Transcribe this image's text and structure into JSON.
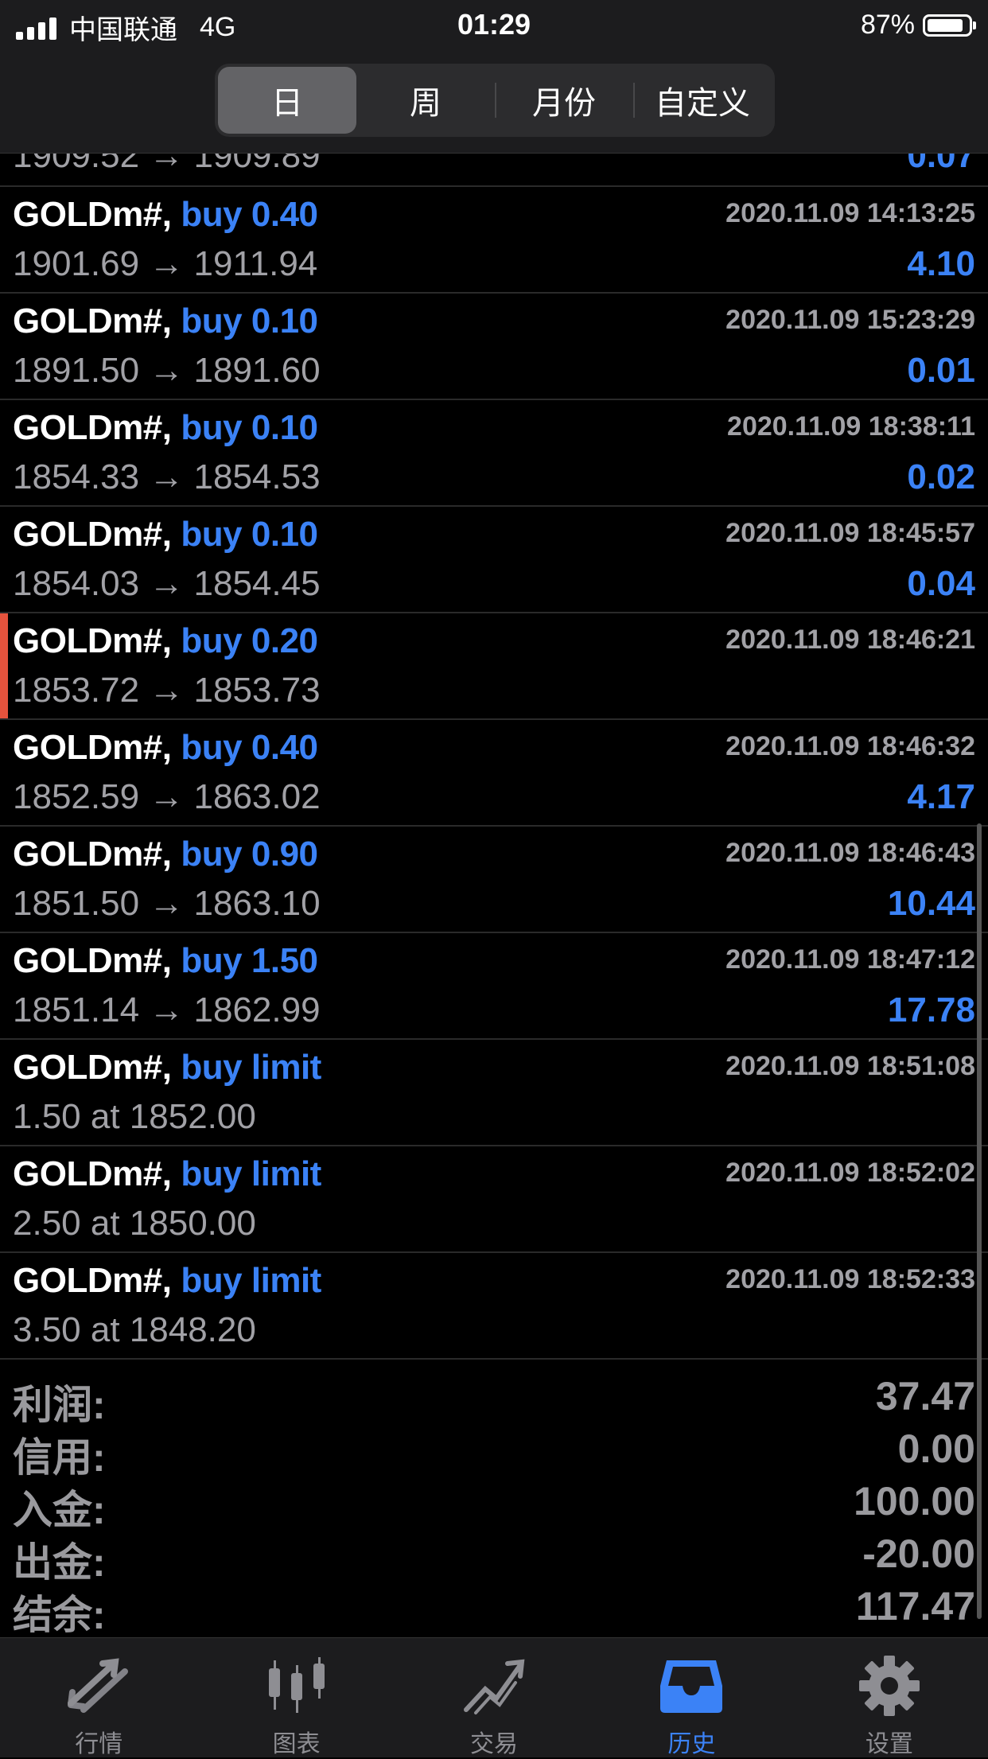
{
  "status_bar": {
    "carrier": "中国联通",
    "network": "4G",
    "time": "01:29",
    "battery": "87%",
    "battery_level": 0.87
  },
  "segments": [
    {
      "label": "日",
      "active": true
    },
    {
      "label": "周",
      "active": false
    },
    {
      "label": "月份",
      "active": false
    },
    {
      "label": "自定义",
      "active": false
    }
  ],
  "partial_row": {
    "prices": "1909.52 → 1909.89",
    "profit": "0.07"
  },
  "trades": [
    {
      "symbol": "GOLDm#,",
      "type": "buy 0.40",
      "datetime": "2020.11.09 14:13:25",
      "prices": "1901.69 → 1911.94",
      "profit": "4.10"
    },
    {
      "symbol": "GOLDm#,",
      "type": "buy 0.10",
      "datetime": "2020.11.09 15:23:29",
      "prices": "1891.50 → 1891.60",
      "profit": "0.01"
    },
    {
      "symbol": "GOLDm#,",
      "type": "buy 0.10",
      "datetime": "2020.11.09 18:38:11",
      "prices": "1854.33 → 1854.53",
      "profit": "0.02"
    },
    {
      "symbol": "GOLDm#,",
      "type": "buy 0.10",
      "datetime": "2020.11.09 18:45:57",
      "prices": "1854.03 → 1854.45",
      "profit": "0.04"
    },
    {
      "symbol": "GOLDm#,",
      "type": "buy 0.20",
      "datetime": "2020.11.09 18:46:21",
      "prices": "1853.72 → 1853.73",
      "profit": ""
    },
    {
      "symbol": "GOLDm#,",
      "type": "buy 0.40",
      "datetime": "2020.11.09 18:46:32",
      "prices": "1852.59 → 1863.02",
      "profit": "4.17"
    },
    {
      "symbol": "GOLDm#,",
      "type": "buy 0.90",
      "datetime": "2020.11.09 18:46:43",
      "prices": "1851.50 → 1863.10",
      "profit": "10.44"
    },
    {
      "symbol": "GOLDm#,",
      "type": "buy 1.50",
      "datetime": "2020.11.09 18:47:12",
      "prices": "1851.14 → 1862.99",
      "profit": "17.78"
    },
    {
      "symbol": "GOLDm#,",
      "type": "buy limit",
      "datetime": "2020.11.09 18:51:08",
      "prices": "1.50 at 1852.00",
      "profit": ""
    },
    {
      "symbol": "GOLDm#,",
      "type": "buy limit",
      "datetime": "2020.11.09 18:52:02",
      "prices": "2.50 at 1850.00",
      "profit": ""
    },
    {
      "symbol": "GOLDm#,",
      "type": "buy limit",
      "datetime": "2020.11.09 18:52:33",
      "prices": "3.50 at 1848.20",
      "profit": ""
    }
  ],
  "summary": [
    {
      "label": "利润:",
      "value": "37.47"
    },
    {
      "label": "信用:",
      "value": "0.00"
    },
    {
      "label": "入金:",
      "value": "100.00"
    },
    {
      "label": "出金:",
      "value": "-20.00"
    },
    {
      "label": "结余:",
      "value": "117.47"
    }
  ],
  "tabs": [
    {
      "label": "行情",
      "icon": "quotes-arrows-icon",
      "active": false
    },
    {
      "label": "图表",
      "icon": "candlestick-chart-icon",
      "active": false
    },
    {
      "label": "交易",
      "icon": "trade-trend-icon",
      "active": false
    },
    {
      "label": "历史",
      "icon": "history-inbox-icon",
      "active": true
    },
    {
      "label": "设置",
      "icon": "gear-icon",
      "active": false
    }
  ],
  "colors": {
    "accent": "#3b82f6",
    "flag": "#e5533d",
    "muted": "#a1a1a6",
    "bar_bg": "#1c1c1e"
  }
}
